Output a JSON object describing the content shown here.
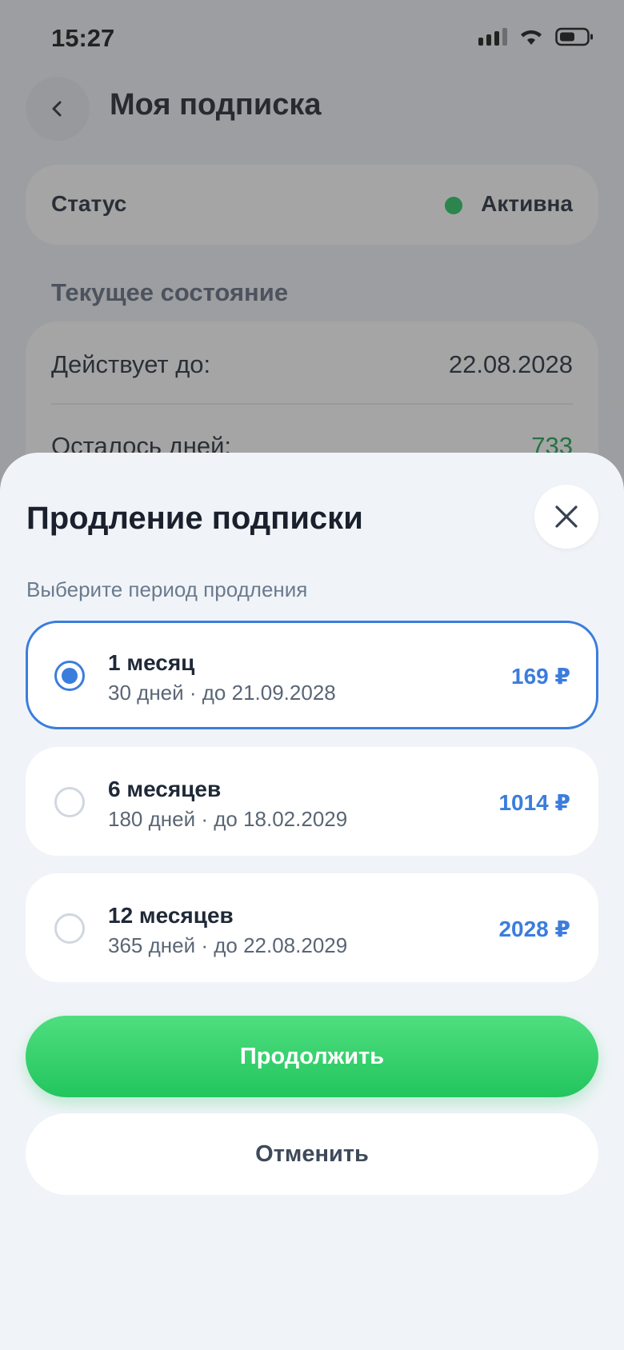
{
  "status_bar": {
    "time": "15:27"
  },
  "header": {
    "title": "Моя подписка"
  },
  "status_card": {
    "label": "Статус",
    "value": "Активна",
    "dot_color": "#22c55e"
  },
  "current_state": {
    "section_title": "Текущее состояние",
    "valid_until_label": "Действует до:",
    "valid_until_value": "22.08.2028",
    "days_left_label": "Осталось дней:",
    "days_left_value": "733"
  },
  "sheet": {
    "title": "Продление подписки",
    "subtitle": "Выберите период продления",
    "options": [
      {
        "title": "1 месяц",
        "desc": "30 дней · до 21.09.2028",
        "price": "169 ₽",
        "selected": true
      },
      {
        "title": "6 месяцев",
        "desc": "180 дней · до 18.02.2029",
        "price": "1014 ₽",
        "selected": false
      },
      {
        "title": "12 месяцев",
        "desc": "365 дней · до 22.08.2029",
        "price": "2028 ₽",
        "selected": false
      }
    ],
    "continue_label": "Продолжить",
    "cancel_label": "Отменить"
  },
  "colors": {
    "accent": "#3b7ddd",
    "success": "#22c55e"
  }
}
